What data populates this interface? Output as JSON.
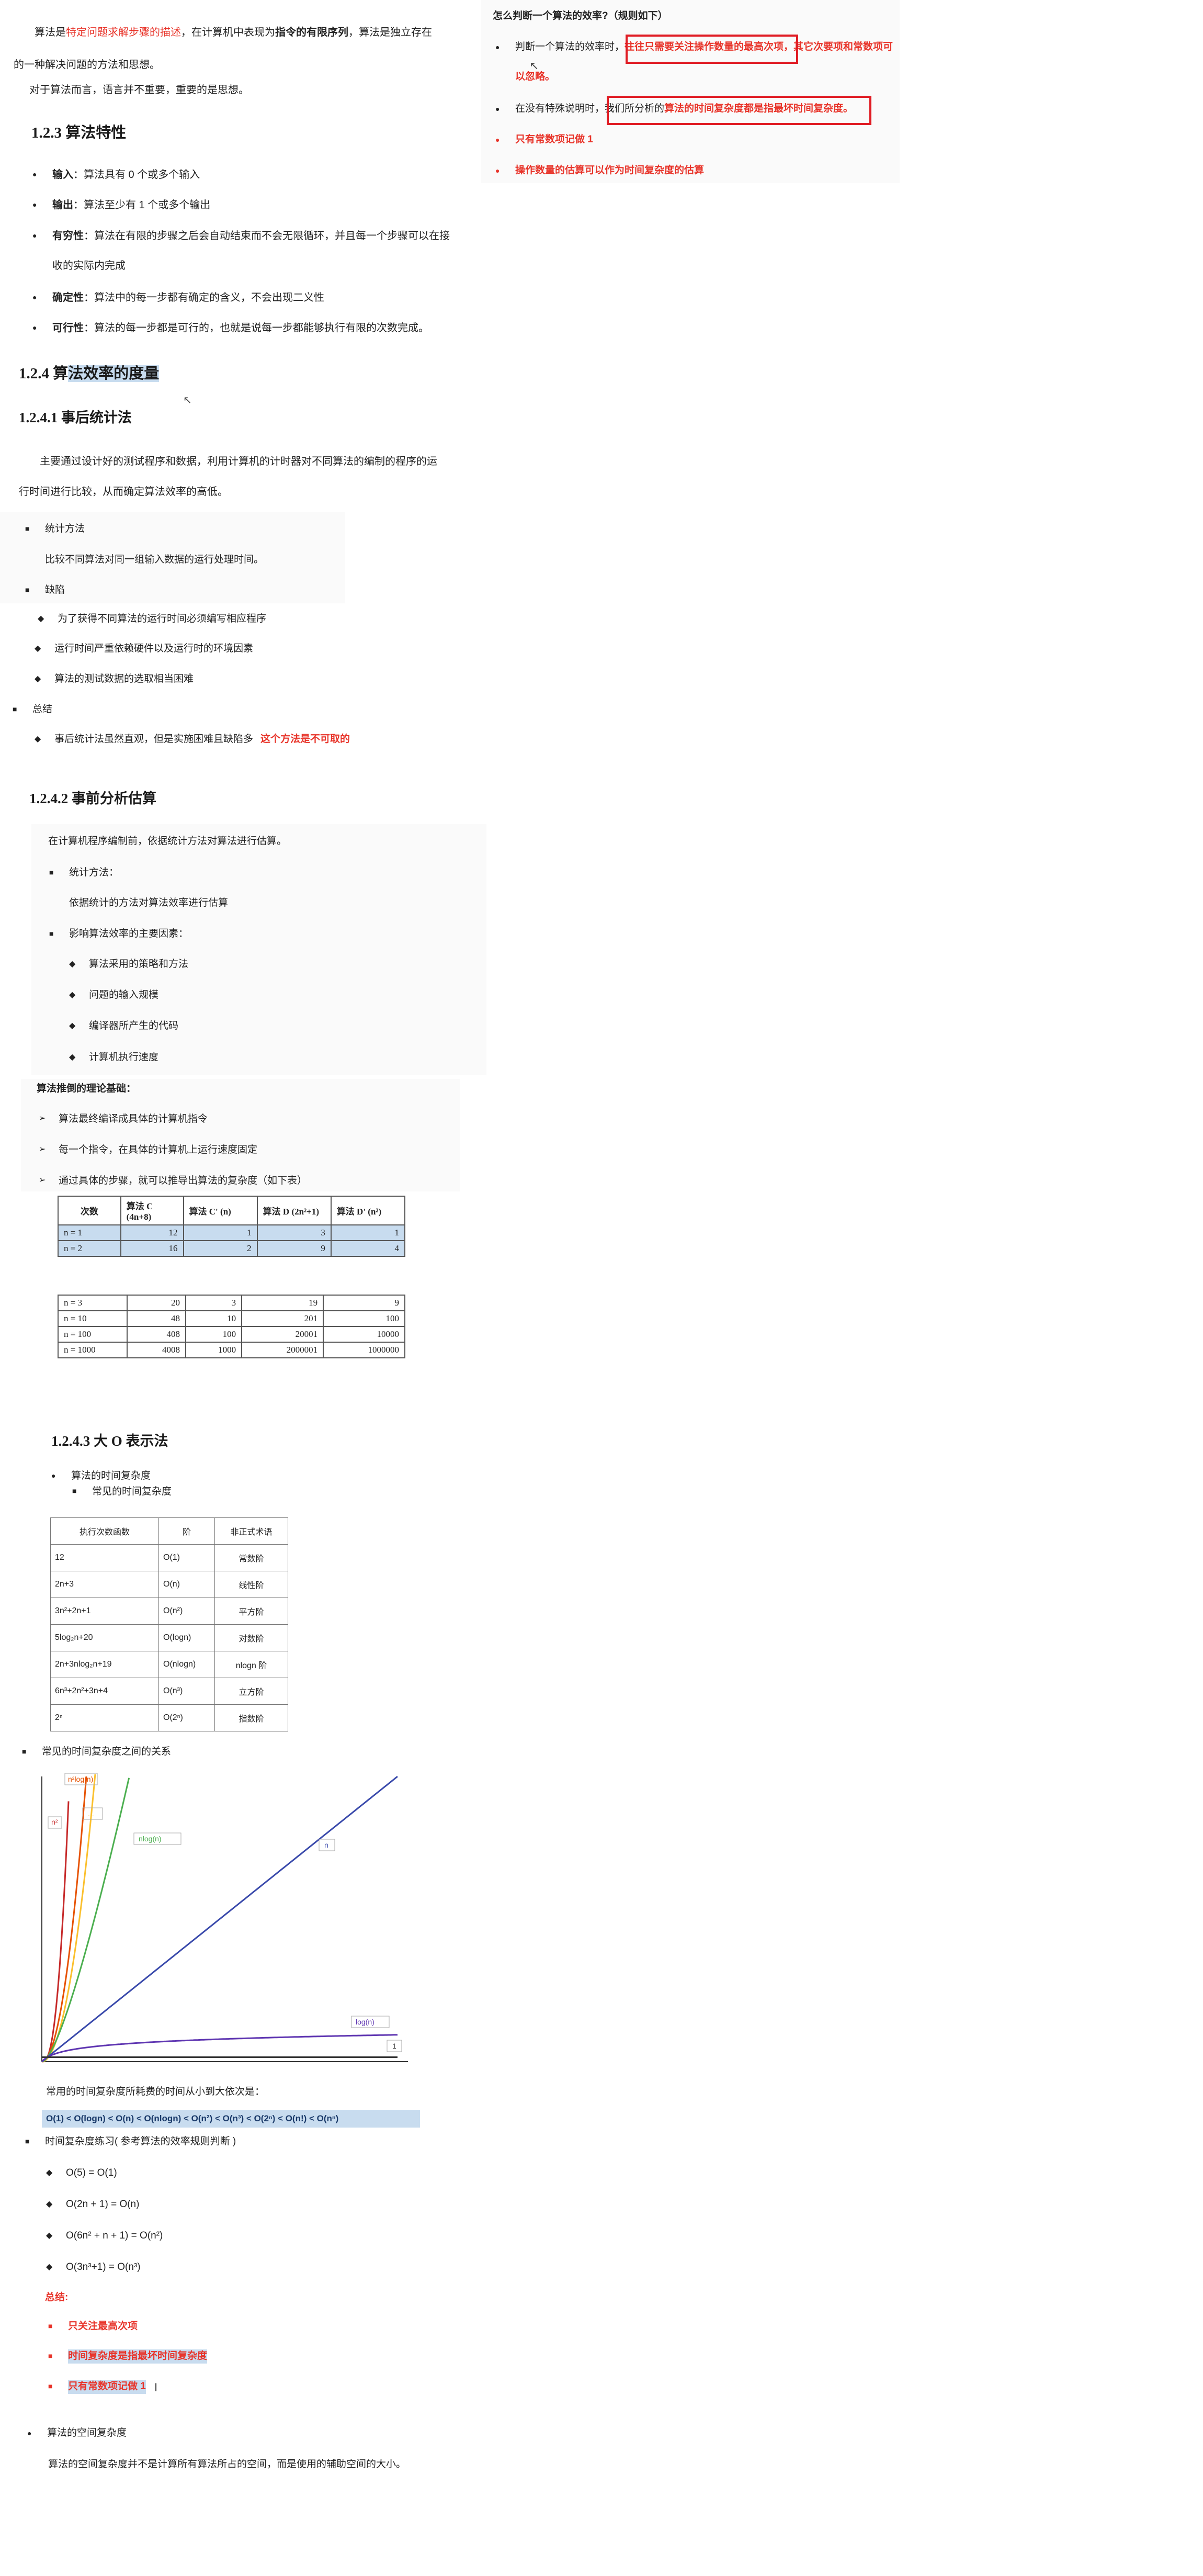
{
  "left": {
    "intro1": {
      "pre": "算法是",
      "red": "特定问题求解步骤的描述",
      "mid": "，在计算机中表现为",
      "bold": "指令的有限序列",
      "post": "，算法是独立存在"
    },
    "intro2": "的一种解决问题的方法和思想。",
    "intro3": "对于算法而言，语言并不重要，重要的是思想。",
    "h123": "1.2.3 算法特性",
    "features": [
      {
        "term": "输入",
        "text": "：算法具有 0 个或多个输入"
      },
      {
        "term": "输出",
        "text": "：算法至少有 1 个或多个输出"
      },
      {
        "term": "有穷性",
        "text": "：算法在有限的步骤之后会自动结束而不会无限循环，并且每一个步骤可以在接"
      },
      {
        "term": "",
        "text": "收的实际内完成"
      },
      {
        "term": "确定性",
        "text": "：算法中的每一步都有确定的含义，不会出现二义性"
      },
      {
        "term": "可行性",
        "text": "：算法的每一步都是可行的，也就是说每一步都能够执行有限的次数完成。"
      }
    ],
    "h124": {
      "pre": "1.2.4 算",
      "sel": "法效率的度量"
    },
    "h1241": "1.2.4.1 事后统计法",
    "post_desc1": "主要通过设计好的测试程序和数据，利用计算机的计时器对不同算法的编制的程序的运",
    "post_desc2": "行时间进行比较，从而确定算法效率的高低。",
    "stat_method": "统计方法",
    "stat_method_desc": "比较不同算法对同一组输入数据的运行处理时间。",
    "defects": "缺陷",
    "defect_items": [
      "为了获得不同算法的运行时间必须编写相应程序",
      "运行时间严重依赖硬件以及运行时的环境因素",
      "算法的测试数据的选取相当困难"
    ],
    "summary": "总结",
    "summary_item": "事后统计法虽然直观，但是实施困难且缺陷多",
    "summary_red": "这个方法是不可取的",
    "h1242": "1.2.4.2 事前分析估算",
    "pre_desc": "在计算机程序编制前，依据统计方法对算法进行估算。",
    "pre_stat": "统计方法：",
    "pre_stat_desc": "依据统计的方法对算法效率进行估算",
    "factors": "影响算法效率的主要因素：",
    "factor_items": [
      "算法采用的策略和方法",
      "问题的输入规模",
      "编译器所产生的代码",
      "计算机执行速度"
    ],
    "theory": "算法推倒的理论基础：",
    "theory_items": [
      "算法最终编译成具体的计算机指令",
      "每一个指令，在具体的计算机上运行速度固定",
      "通过具体的步骤，就可以推导出算法的复杂度（如下表）"
    ],
    "table1": {
      "headers": [
        "次数",
        "算法 C (4n+8)",
        "算法 C' (n)",
        "算法 D (2n²+1)",
        "算法 D' (n²)"
      ],
      "rows": [
        [
          "n = 1",
          "12",
          "1",
          "3",
          "1"
        ],
        [
          "n = 2",
          "16",
          "2",
          "9",
          "4"
        ]
      ]
    },
    "table2": {
      "rows": [
        [
          "n = 3",
          "20",
          "3",
          "19",
          "9"
        ],
        [
          "n = 10",
          "48",
          "10",
          "201",
          "100"
        ],
        [
          "n = 100",
          "408",
          "100",
          "20001",
          "10000"
        ],
        [
          "n = 1000",
          "4008",
          "1000",
          "2000001",
          "1000000"
        ]
      ]
    },
    "h1243": "1.2.4.3 大 O 表示法",
    "time_complexity": "算法的时间复杂度",
    "common_tc": "常见的时间复杂度",
    "table3": {
      "headers": [
        "执行次数函数",
        "阶",
        "非正式术语"
      ],
      "rows": [
        [
          "12",
          "O(1)",
          "常数阶"
        ],
        [
          "2n+3",
          "O(n)",
          "线性阶"
        ],
        [
          "3n²+2n+1",
          "O(n²)",
          "平方阶"
        ],
        [
          "5log₂n+20",
          "O(logn)",
          "对数阶"
        ],
        [
          "2n+3nlog₂n+19",
          "O(nlogn)",
          "nlogn 阶"
        ],
        [
          "6n³+2n²+3n+4",
          "O(n³)",
          "立方阶"
        ],
        [
          "2ⁿ",
          "O(2ⁿ)",
          "指数阶"
        ]
      ]
    },
    "relation": "常见的时间复杂度之间的关系",
    "chart_labels": {
      "n2log": "n²log(n)",
      "n2": "n²",
      "dots": "...",
      "nlog": "nlog(n)",
      "n": "n",
      "logn": "log(n)",
      "one": "1"
    },
    "order_desc": "常用的时间复杂度所耗费的时间从小到大依次是：",
    "order_line": "O(1) < O(logn) < O(n) < O(nlogn) < O(n²) < O(n³) < O(2ⁿ) < O(n!) < O(nⁿ)",
    "practice": "时间复杂度练习(  参考算法的效率规则判断  )",
    "practice_items": [
      "O(5) = O(1)",
      "O(2n + 1) = O(n)",
      "O(6n² + n + 1) = O(n²)",
      "O(3n³+1) = O(n³)"
    ],
    "sum_title": "总结:",
    "sum_items": [
      "只关注最高次项",
      "时间复杂度是指最坏时间复杂度",
      "只有常数项记做 1"
    ],
    "space": "算法的空间复杂度",
    "space_desc": "算法的空间复杂度并不是计算所有算法所占的空间，而是使用的辅助空间的大小。"
  },
  "right": {
    "title": "怎么判断一个算法的效率?（规则如下）",
    "r1": {
      "pre": "判断一个算法的效率时，",
      "boxed": "往往只需要关注操作数量的最高次项",
      "post": "，其它次要项和常数项可"
    },
    "r1b": "以忽略。",
    "r2": {
      "pre": "在没有特殊说明时，",
      "boxed_a": "我们所分析的",
      "boxed_b": "算法的时间复杂度都是指最坏时间复杂度。"
    },
    "r3": "只有常数项记做 1",
    "r4": "操作数量的估算可以作为时间复杂度的估算"
  },
  "colors": {
    "accent_red": "#e8342a",
    "highlight": "#c8dcef",
    "box_red": "#e01c24"
  },
  "chart_data": {
    "type": "line",
    "title": "",
    "series": [
      {
        "name": "n²log(n)",
        "color": "#c62828"
      },
      {
        "name": "n²",
        "color": "#e65100"
      },
      {
        "name": "...",
        "color": "#fbc02d"
      },
      {
        "name": "nlog(n)",
        "color": "#4caf50"
      },
      {
        "name": "n",
        "color": "#3949ab"
      },
      {
        "name": "log(n)",
        "color": "#5e35b1"
      },
      {
        "name": "1",
        "color": "#333333"
      }
    ],
    "grid": false
  }
}
